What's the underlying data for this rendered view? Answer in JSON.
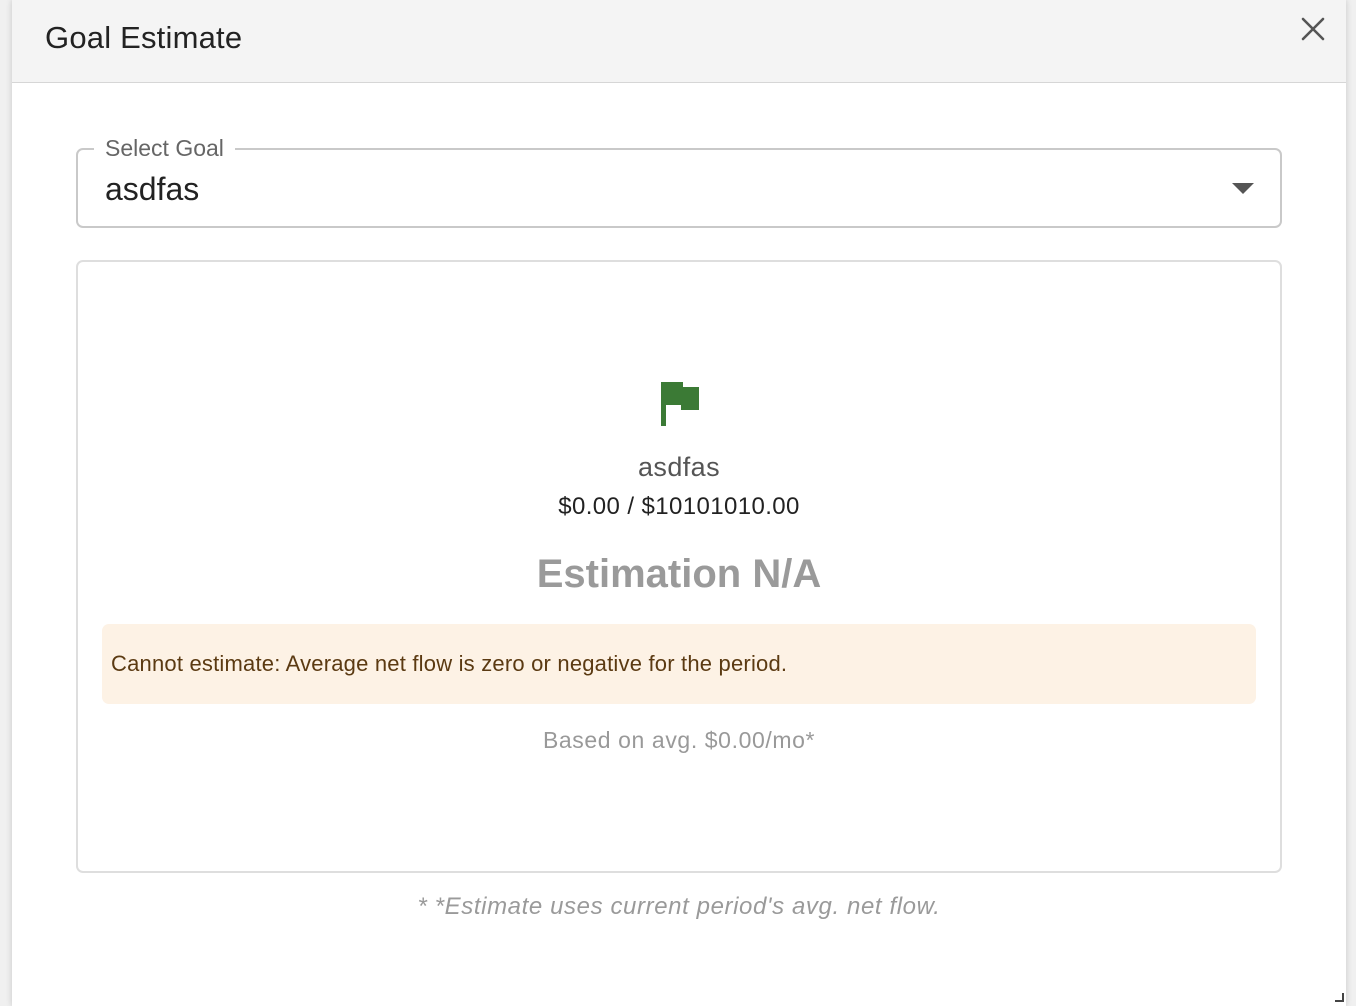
{
  "dialog": {
    "title": "Goal Estimate",
    "close_icon": "close-icon"
  },
  "select": {
    "label": "Select Goal",
    "value": "asdfas",
    "arrow_icon": "dropdown-arrow-icon"
  },
  "card": {
    "icon": "flag-icon",
    "icon_color": "#3b7a35",
    "goal_name": "asdfas",
    "goal_amount": "$0.00 / $10101010.00",
    "estimation": "Estimation N/A",
    "warning": "Cannot estimate: Average net flow is zero or negative for the period.",
    "based_on": "Based on avg. $0.00/mo*"
  },
  "footnote": "* *Estimate uses current period's avg. net flow.",
  "colors": {
    "warning_bg": "#fdf2e5",
    "warning_text": "#5b3a12",
    "muted_text": "#9a9a9a"
  }
}
